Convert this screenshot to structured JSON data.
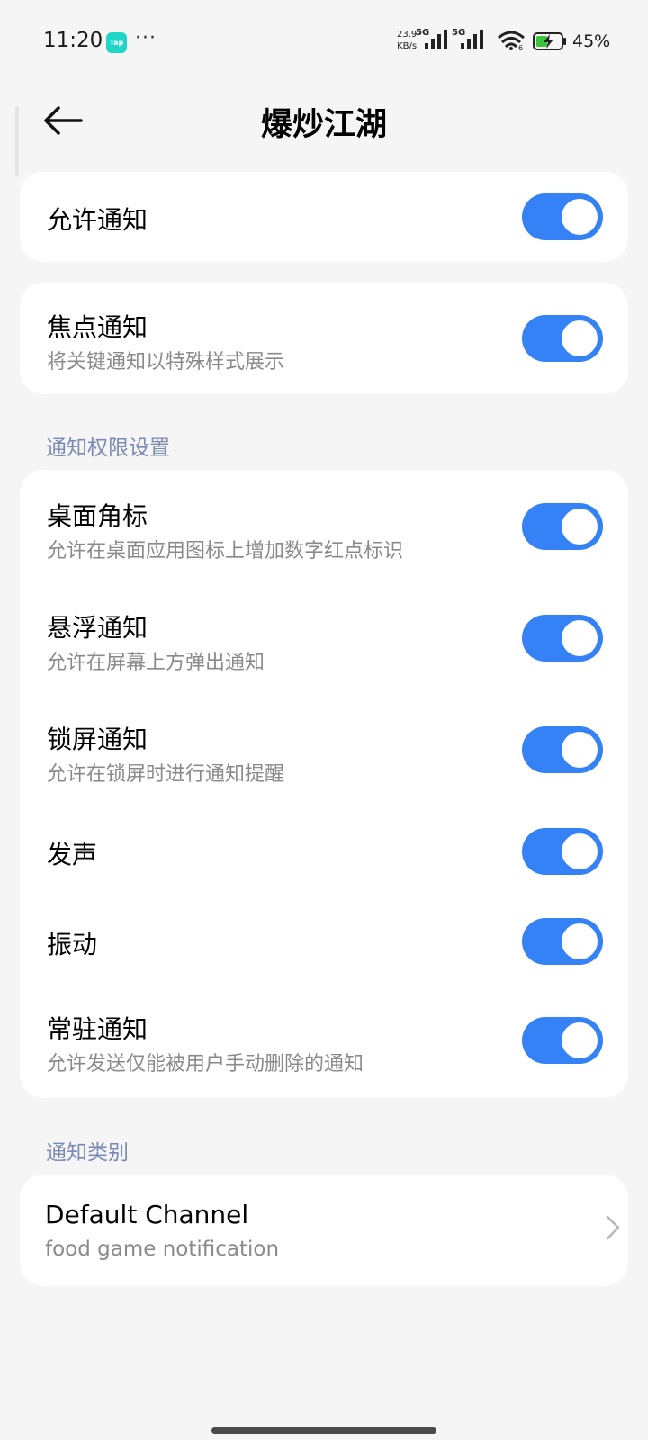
{
  "status_bar": {
    "time": "11:20",
    "tap_badge": "Tap",
    "more": "···",
    "speed_value": "23.9",
    "speed_unit": "KB/s",
    "network_1": "5G",
    "network_2": "5G",
    "wifi_sub": "6",
    "battery": "45%"
  },
  "header": {
    "title": "爆炒江湖"
  },
  "allow_notifications": {
    "label": "允许通知",
    "enabled": true
  },
  "focus_notifications": {
    "label": "焦点通知",
    "description": "将关键通知以特殊样式展示",
    "enabled": true
  },
  "permission_section": {
    "header": "通知权限设置",
    "items": [
      {
        "label": "桌面角标",
        "description": "允许在桌面应用图标上增加数字红点标识",
        "enabled": true
      },
      {
        "label": "悬浮通知",
        "description": "允许在屏幕上方弹出通知",
        "enabled": true
      },
      {
        "label": "锁屏通知",
        "description": "允许在锁屏时进行通知提醒",
        "enabled": true
      },
      {
        "label": "发声",
        "description": "",
        "enabled": true
      },
      {
        "label": "振动",
        "description": "",
        "enabled": true
      },
      {
        "label": "常驻通知",
        "description": "允许发送仅能被用户手动删除的通知",
        "enabled": true
      }
    ]
  },
  "category_section": {
    "header": "通知类别",
    "channel_name": "Default Channel",
    "channel_description": "food game notification"
  },
  "colors": {
    "accent": "#3482f6",
    "background": "#f5f5f5",
    "section_label": "#7a8ab3"
  }
}
